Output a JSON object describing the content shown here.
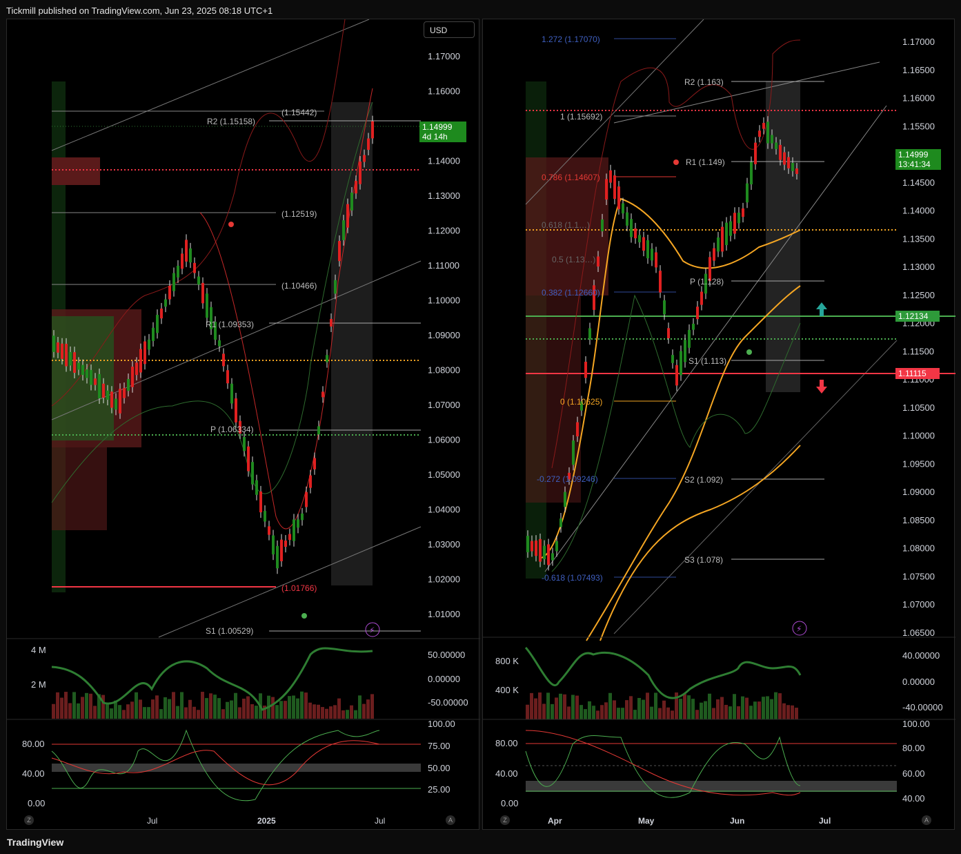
{
  "header": {
    "published": "Tickmill published on TradingView.com, Jun 23, 2025 08:18 UTC+1"
  },
  "footer": {
    "brand": "TradingView"
  },
  "left": {
    "currency": "USD",
    "price_axis": [
      "1.17000",
      "1.16000",
      "1.15000",
      "1.14000",
      "1.13000",
      "1.12000",
      "1.11000",
      "1.10000",
      "1.09000",
      "1.08000",
      "1.07000",
      "1.06000",
      "1.05000",
      "1.04000",
      "1.03000",
      "1.02000",
      "1.01000"
    ],
    "current_price": "1.14999",
    "countdown": "4d 14h",
    "levels": {
      "r2": "R2 (1.15158)",
      "h1": "(1.15442)",
      "h2": "(1.12519)",
      "h3": "(1.10466)",
      "r1": "R1 (1.09353)",
      "p": "P (1.06334)",
      "low": "(1.01766)",
      "s1": "S1 (1.00529)"
    },
    "volume_axis": [
      "4 M",
      "2 M"
    ],
    "rsi_axis": [
      "50.00000",
      "0.00000",
      "-50.00000"
    ],
    "stoch_left": [
      "80.00",
      "40.00",
      "0.00"
    ],
    "stoch_right": [
      "100.00",
      "75.00",
      "50.00",
      "25.00"
    ],
    "time_axis": [
      "Jul",
      "2025",
      "Jul"
    ],
    "badges": [
      "Z",
      "A"
    ]
  },
  "right": {
    "price_axis": [
      "1.17000",
      "1.16500",
      "1.16000",
      "1.15500",
      "1.15000",
      "1.14500",
      "1.14000",
      "1.13500",
      "1.13000",
      "1.12500",
      "1.12000",
      "1.11500",
      "1.11000",
      "1.10500",
      "1.10000",
      "1.09500",
      "1.09000",
      "1.08500",
      "1.08000",
      "1.07500",
      "1.07000",
      "1.06500"
    ],
    "current_price": "1.14999",
    "countdown": "13:41:34",
    "green_level": "1.12134",
    "red_level": "1.11115",
    "levels": {
      "fib1272": "1.272 (1.17070)",
      "r2": "R2 (1.163)",
      "fib1": "1 (1.15692)",
      "r1": "R1 (1.149)",
      "fib786": "0.786 (1.14607)",
      "fib618": "0.618 (1.1…)",
      "fib5": "0.5 (1.13…)",
      "p": "P (1.128)",
      "fib382": "0.382 (1.12660)",
      "s1": "S1 (1.113)",
      "fib0": "0 (1.10625)",
      "fibm272": "-0.272 (1.09246)",
      "s2": "S2 (1.092)",
      "s3": "S3 (1.078)",
      "fibm618": "-0.618 (1.07493)"
    },
    "volume_axis": [
      "800 K",
      "400 K"
    ],
    "rsi_axis": [
      "40.00000",
      "0.00000",
      "-40.00000"
    ],
    "stoch_left": [
      "80.00",
      "40.00",
      "0.00"
    ],
    "stoch_right": [
      "100.00",
      "80.00",
      "60.00",
      "40.00"
    ],
    "time_axis": [
      "Apr",
      "May",
      "Jun",
      "Jul"
    ],
    "badges": [
      "Z",
      "A"
    ]
  },
  "colors": {
    "up": "#1f8a1f",
    "down": "#e02020",
    "green_line": "#4caf50",
    "red_line": "#f23645",
    "orange": "#f5a623",
    "panel": "#000000"
  }
}
